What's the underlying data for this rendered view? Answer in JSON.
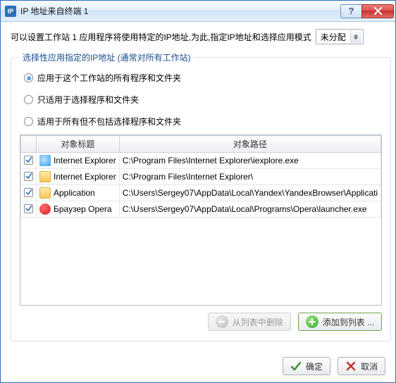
{
  "window": {
    "title": "IP 地址来自终端 1",
    "help_label": "?",
    "close_label": "X"
  },
  "intro": {
    "text": "可以设置工作站 1 应用程序将使用特定的IP地址,为此,指定IP地址和选择应用模式",
    "mode_value": "未分配"
  },
  "group": {
    "legend": "选择性应用指定的IP地址 (通常对所有工作站)",
    "radios": [
      {
        "label": "应用于这个工作站的所有程序和文件夹",
        "checked": true
      },
      {
        "label": "只适用于选择程序和文件夹",
        "checked": false
      },
      {
        "label": "适用于所有但不包括选择程序和文件夹",
        "checked": false
      }
    ]
  },
  "table": {
    "headers": {
      "title": "对象标题",
      "path": "对象路径"
    },
    "rows": [
      {
        "checked": true,
        "icon": "ie",
        "title": "Internet Explorer",
        "path": "C:\\Program Files\\Internet Explorer\\iexplore.exe"
      },
      {
        "checked": true,
        "icon": "folder",
        "title": "Internet Explorer",
        "path": "C:\\Program Files\\Internet Explorer\\"
      },
      {
        "checked": true,
        "icon": "folder",
        "title": "Application",
        "path": "C:\\Users\\Sergey07\\AppData\\Local\\Yandex\\YandexBrowser\\Applicati"
      },
      {
        "checked": true,
        "icon": "opera",
        "title": "Браузер Opera",
        "path": "C:\\Users\\Sergey07\\AppData\\Local\\Programs\\Opera\\launcher.exe"
      }
    ]
  },
  "actions": {
    "remove": "从列表中删除",
    "add": "添加到列表 ..."
  },
  "dialog": {
    "ok": "确定",
    "cancel": "取消"
  }
}
